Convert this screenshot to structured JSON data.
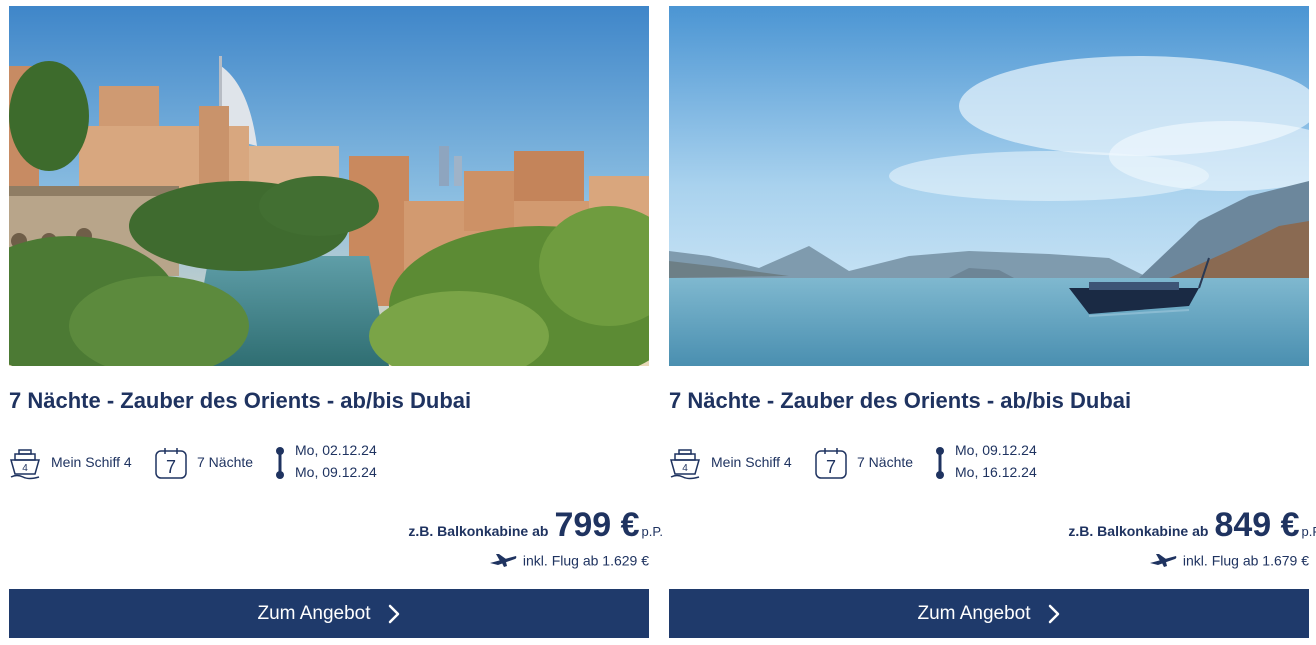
{
  "offers": [
    {
      "image_alt": "Dubai",
      "title": "7 Nächte - Zauber des Orients - ab/bis Dubai",
      "ship_icon": "ship-icon",
      "ship_number": "4",
      "ship_label": "Mein Schiff 4",
      "calendar_icon": "calendar-icon",
      "nights_number": "7",
      "nights_label": "7 Nächte",
      "date_from": "Mo, 02.12.24",
      "date_to": "Mo, 09.12.24",
      "price_prefix": "z.B. Balkonkabine ab",
      "price_value": "799 €",
      "price_suffix": "p.P.",
      "flight_text": "inkl. Flug ab 1.629 €",
      "cta_label": "Zum Angebot"
    },
    {
      "image_alt": "Khasab",
      "title": "7 Nächte - Zauber des Orients - ab/bis Dubai",
      "ship_icon": "ship-icon",
      "ship_number": "4",
      "ship_label": "Mein Schiff 4",
      "calendar_icon": "calendar-icon",
      "nights_number": "7",
      "nights_label": "7 Nächte",
      "date_from": "Mo, 09.12.24",
      "date_to": "Mo, 16.12.24",
      "price_prefix": "z.B. Balkonkabine ab",
      "price_value": "849 €",
      "price_suffix": "p.P.",
      "flight_text": "inkl. Flug ab 1.679 €",
      "cta_label": "Zum Angebot"
    }
  ],
  "colors": {
    "brand_navy": "#1f3360",
    "button_bg": "#1f3a6b",
    "button_text": "#ffffff"
  }
}
